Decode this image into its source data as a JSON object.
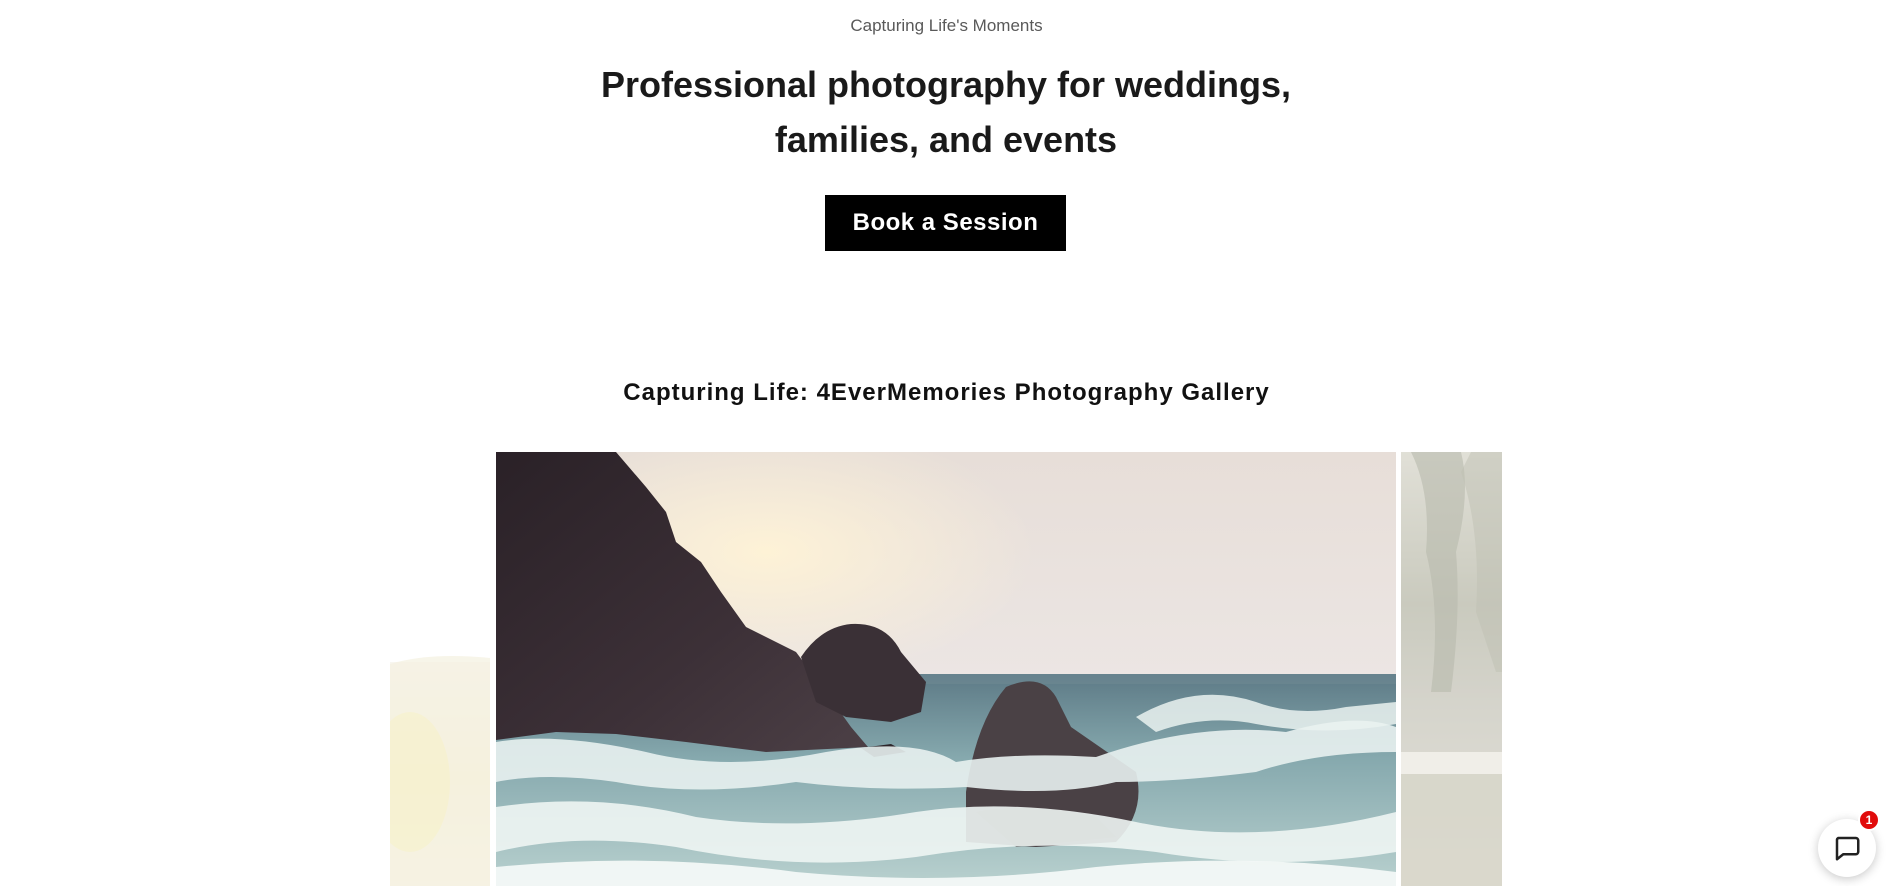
{
  "hero": {
    "eyebrow": "Capturing Life's Moments",
    "headline": "Professional photography for weddings, families, and events",
    "cta_label": "Book a Session"
  },
  "gallery": {
    "title": "Capturing Life: 4EverMemories Photography Gallery",
    "slides": [
      {
        "position": "previous",
        "subject": "bright soft-focus landscape"
      },
      {
        "position": "current",
        "subject": "rocky coast with crashing waves"
      },
      {
        "position": "next",
        "subject": "misty trees by the water"
      }
    ]
  },
  "chat": {
    "icon": "chat-bubble-icon",
    "badge_count": "1",
    "badge_color": "#e10b0b"
  },
  "colors": {
    "cta_background": "#000000",
    "cta_text": "#ffffff",
    "eyebrow_text": "#595959",
    "page_background": "#ffffff"
  }
}
